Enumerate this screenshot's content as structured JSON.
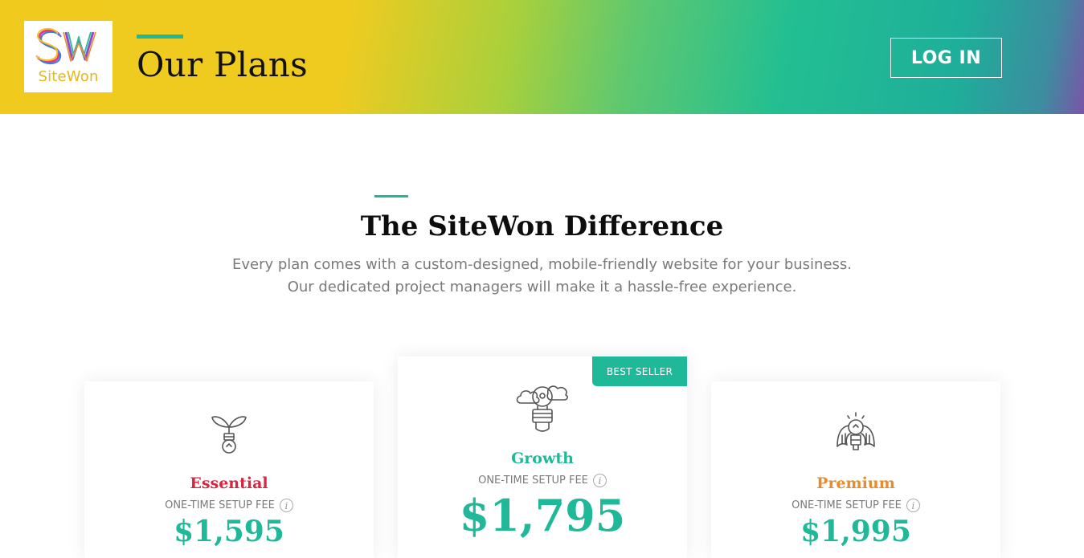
{
  "header": {
    "logo_text": "SiteWon",
    "title": "Our Plans",
    "login_label": "LOG IN"
  },
  "intro": {
    "title": "The SiteWon Difference",
    "line1": "Every plan comes with a custom-designed, mobile-friendly website for your business.",
    "line2": "Our dedicated project managers will make it a hassle-free experience."
  },
  "plans": [
    {
      "name": "Essential",
      "fee_label": "ONE-TIME SETUP FEE",
      "price": "$1,595",
      "color": "#d9253f",
      "icon": "plant-bulb-icon"
    },
    {
      "name": "Growth",
      "fee_label": "ONE-TIME SETUP FEE",
      "price": "$1,795",
      "color": "#1fb99a",
      "icon": "balloon-bulb-icon",
      "badge": "BEST SELLER"
    },
    {
      "name": "Premium",
      "fee_label": "ONE-TIME SETUP FEE",
      "price": "$1,995",
      "color": "#e88b2a",
      "icon": "winged-bulb-icon"
    }
  ],
  "colors": {
    "accent": "#1fb99a"
  }
}
